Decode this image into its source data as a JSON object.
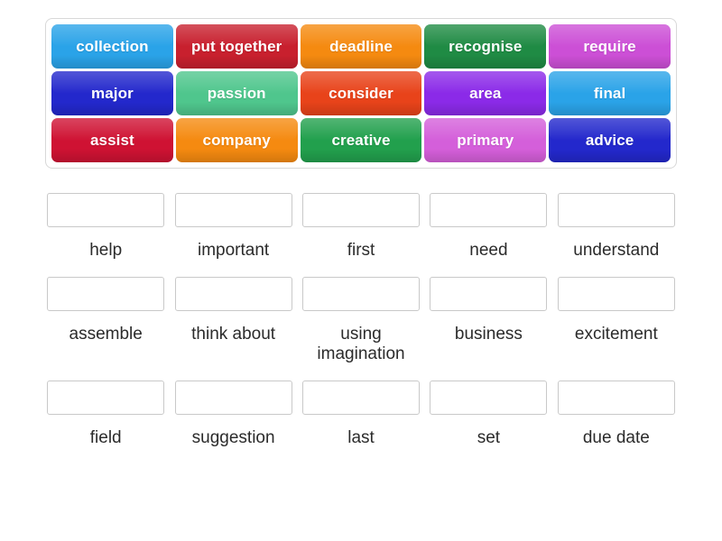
{
  "tile_tray": {
    "name": "word-tiles",
    "rows": [
      [
        {
          "label": "collection",
          "color": "#2aa3e8"
        },
        {
          "label": "put together",
          "color": "#c8202e"
        },
        {
          "label": "deadline",
          "color": "#f58a10"
        },
        {
          "label": "recognise",
          "color": "#1f8b44"
        },
        {
          "label": "require",
          "color": "#cc4fd6"
        }
      ],
      [
        {
          "label": "major",
          "color": "#2328cc"
        },
        {
          "label": "passion",
          "color": "#4fc68d"
        },
        {
          "label": "consider",
          "color": "#e8431a"
        },
        {
          "label": "area",
          "color": "#8b2ae8"
        },
        {
          "label": "final",
          "color": "#2aa3e8"
        }
      ],
      [
        {
          "label": "assist",
          "color": "#cf1233"
        },
        {
          "label": "company",
          "color": "#f58a10"
        },
        {
          "label": "creative",
          "color": "#22a04d"
        },
        {
          "label": "primary",
          "color": "#d45fda"
        },
        {
          "label": "advice",
          "color": "#2328cc"
        }
      ]
    ]
  },
  "answer_grid": {
    "rows": [
      [
        {
          "label": "help",
          "value": ""
        },
        {
          "label": "important",
          "value": ""
        },
        {
          "label": "first",
          "value": ""
        },
        {
          "label": "need",
          "value": ""
        },
        {
          "label": "understand",
          "value": ""
        }
      ],
      [
        {
          "label": "assemble",
          "value": ""
        },
        {
          "label": "think about",
          "value": ""
        },
        {
          "label": "using\nimagination",
          "value": ""
        },
        {
          "label": "business",
          "value": ""
        },
        {
          "label": "excitement",
          "value": ""
        }
      ],
      [
        {
          "label": "field",
          "value": ""
        },
        {
          "label": "suggestion",
          "value": ""
        },
        {
          "label": "last",
          "value": ""
        },
        {
          "label": "set",
          "value": ""
        },
        {
          "label": "due date",
          "value": ""
        }
      ]
    ]
  },
  "colors": {
    "page_background": "#ffffff",
    "tray_border": "#d8d8d8",
    "drop_box_border": "#c9c9c9",
    "label_text": "#2b2b2b",
    "tile_text": "#ffffff"
  }
}
